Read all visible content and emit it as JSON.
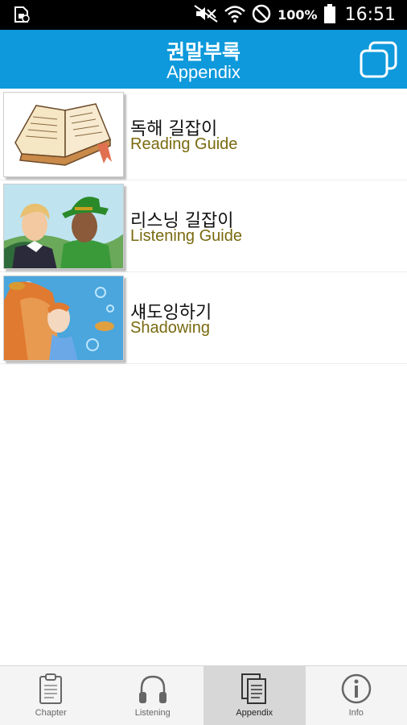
{
  "status_bar": {
    "battery": "100%",
    "time": "16:51",
    "icons": [
      "sim-card-icon",
      "mute-icon",
      "wifi-icon",
      "no-disturb-icon",
      "battery-icon"
    ]
  },
  "header": {
    "title": "권말부록",
    "subtitle": "Appendix",
    "action_icon": "windows-stack-icon",
    "color": "#0d99db"
  },
  "items": [
    {
      "title": "독해 길잡이",
      "subtitle": "Reading Guide",
      "image": "open-book-illustration"
    },
    {
      "title": "리스닝 길잡이",
      "subtitle": "Listening Guide",
      "image": "two-characters-illustration"
    },
    {
      "title": "섀도잉하기",
      "subtitle": "Shadowing",
      "image": "mermaid-illustration"
    }
  ],
  "bottom_nav": {
    "active": "Appendix",
    "tabs": [
      {
        "label": "Chapter",
        "icon": "clipboard-icon"
      },
      {
        "label": "Listening",
        "icon": "headphones-icon"
      },
      {
        "label": "Appendix",
        "icon": "documents-icon"
      },
      {
        "label": "Info",
        "icon": "info-icon"
      }
    ]
  }
}
